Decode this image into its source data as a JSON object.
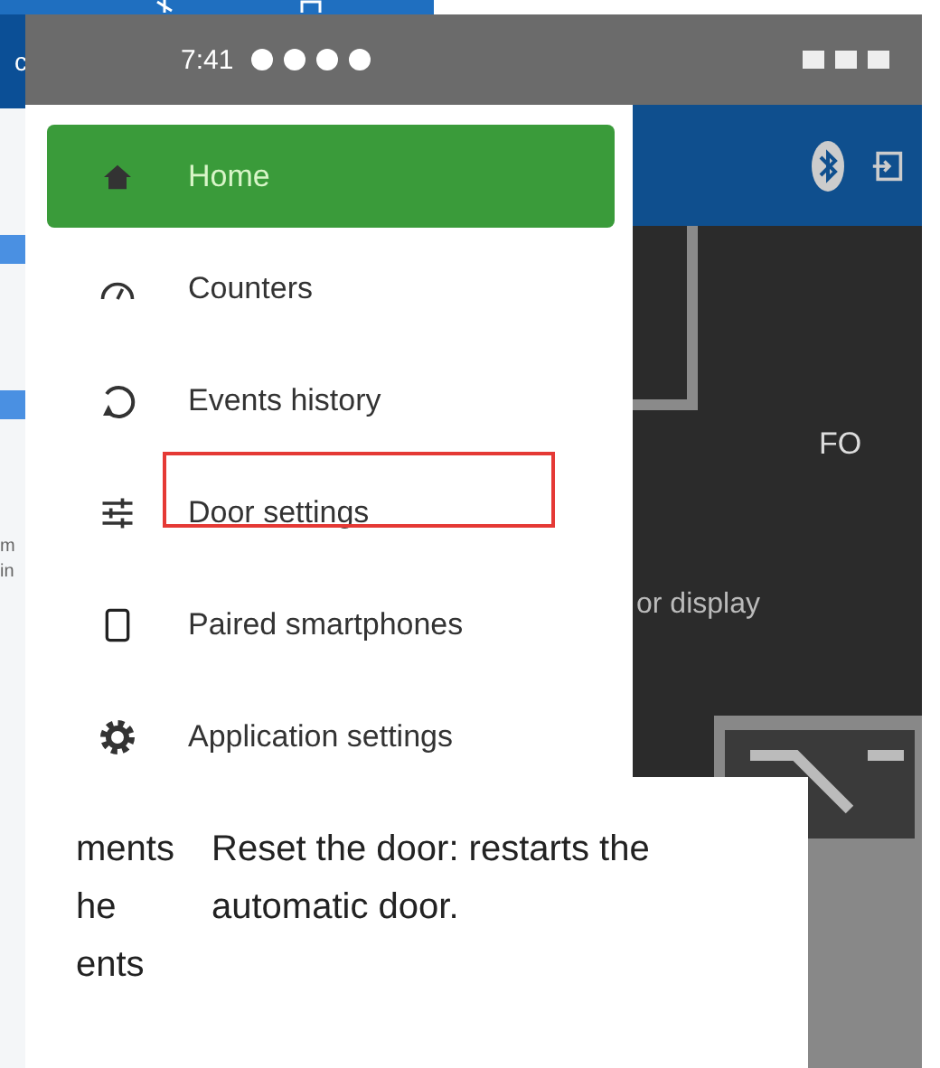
{
  "background_app": {
    "header_label": "c",
    "fragments": [
      "m",
      "in"
    ]
  },
  "phone": {
    "status_bar": {
      "time": "7:41"
    },
    "drawer": {
      "items": [
        {
          "label": "Home",
          "selected": true
        },
        {
          "label": "Counters",
          "selected": false
        },
        {
          "label": "Events history",
          "selected": false
        },
        {
          "label": "Door settings",
          "selected": false
        },
        {
          "label": "Paired smartphones",
          "selected": false
        },
        {
          "label": "Application settings",
          "selected": false
        }
      ]
    },
    "app": {
      "status_value": "FO",
      "caption": "or display"
    }
  },
  "document": {
    "left_column_lines": [
      "ments",
      "he",
      "ents"
    ],
    "right_text": "Reset the door: restarts the automatic door."
  }
}
